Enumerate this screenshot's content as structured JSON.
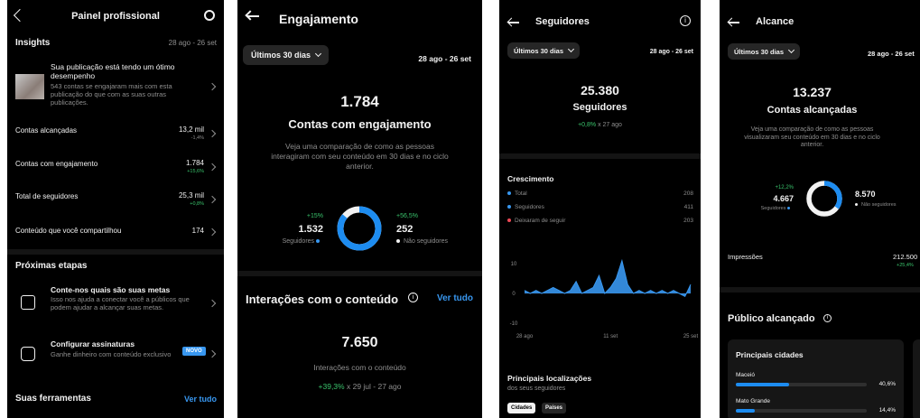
{
  "panel1": {
    "title": "Painel profissional",
    "insights_label": "Insights",
    "date_range": "28 ago - 26 set",
    "post": {
      "title": "Sua publicação está tendo um ótimo desempenho",
      "body": "543 contas se engajaram mais com esta publicação do que com as suas outras publicações."
    },
    "metrics": [
      {
        "label": "Contas alcançadas",
        "value": "13,2 mil",
        "change": "-1,4%"
      },
      {
        "label": "Contas com engajamento",
        "value": "1.784",
        "change": "+15,6%"
      },
      {
        "label": "Total de seguidores",
        "value": "25,3 mil",
        "change": "+0,8%"
      },
      {
        "label": "Conteúdo que você compartilhou",
        "value": "174",
        "change": ""
      }
    ],
    "next_steps_title": "Próximas etapas",
    "goals": {
      "title": "Conte-nos quais são suas metas",
      "body": "Isso nos ajuda a conectar você a públicos que podem ajudar a alcançar suas metas."
    },
    "subscriptions": {
      "title": "Configurar assinaturas",
      "body": "Ganhe dinheiro com conteúdo exclusivo",
      "badge": "NOVO"
    },
    "tools_title": "Suas ferramentas",
    "see_all": "Ver tudo"
  },
  "panel2": {
    "title": "Engajamento",
    "period": "Últimos 30 dias",
    "date_range": "28 ago - 26 set",
    "big_value": "1.784",
    "big_label": "Contas com engajamento",
    "description": "Veja uma comparação de como as pessoas interagiram com seu conteúdo em 30 dias e no ciclo anterior.",
    "followers": {
      "change": "+15%",
      "value": "1.532",
      "label": "Seguidores"
    },
    "non_followers": {
      "change": "+56,5%",
      "value": "252",
      "label": "Não seguidores"
    },
    "donut_fraction": 0.86,
    "interactions_title": "Interações com o conteúdo",
    "see_all": "Ver tudo",
    "interactions_value": "7.650",
    "interactions_label": "Interações com o conteúdo",
    "interactions_change": "+39,3%",
    "interactions_period": "x 29 jul - 27 ago"
  },
  "panel3": {
    "title": "Seguidores",
    "period": "Últimos 30 dias",
    "date_range": "28 ago - 26 set",
    "big_value": "25.380",
    "big_label": "Seguidores",
    "change": "+0,8%",
    "change_period": "x 27 ago",
    "growth_title": "Crescimento",
    "growth_rows": [
      {
        "label": "Total",
        "value": "208",
        "color": "#3897f0"
      },
      {
        "label": "Seguidores",
        "value": "411",
        "color": "#3897f0"
      },
      {
        "label": "Deixaram de seguir",
        "value": "203",
        "color": "#ed4956"
      }
    ],
    "y_ticks": [
      "10",
      "0",
      "-10"
    ],
    "x_ticks": [
      "28 ago",
      "11 set",
      "25 set"
    ],
    "locations_title": "Principais localizações",
    "locations_subtitle": "dos seus seguidores",
    "tabs": [
      "Cidades",
      "Países"
    ]
  },
  "chart_data": {
    "type": "area",
    "x": [
      1,
      2,
      3,
      4,
      5,
      6,
      7,
      8,
      9,
      10,
      11,
      12,
      13,
      14,
      15,
      16,
      17,
      18,
      19,
      20,
      21,
      22,
      23,
      24,
      25,
      26,
      27,
      28,
      29,
      30
    ],
    "values": [
      1,
      0,
      1,
      0,
      1,
      2,
      1,
      0,
      1,
      4,
      0,
      1,
      2,
      6,
      0,
      2,
      5,
      11,
      3,
      0,
      1,
      0,
      1,
      0,
      1,
      0,
      1,
      0,
      -1,
      3
    ],
    "ylim": [
      -10,
      10
    ],
    "x_tick_labels": [
      "28 ago",
      "11 set",
      "25 set"
    ],
    "color": "#3897f0"
  },
  "panel4": {
    "title": "Alcance",
    "period": "Últimos 30 dias",
    "date_range": "28 ago - 26 set",
    "big_value": "13.237",
    "big_label": "Contas alcançadas",
    "description": "Veja uma comparação de como as pessoas visualizaram seu conteúdo em 30 dias e no ciclo anterior.",
    "followers": {
      "change": "+12,2%",
      "value": "4.667",
      "label": "Seguidores"
    },
    "non_followers": {
      "value": "8.570",
      "label": "Não seguidores"
    },
    "donut_fraction": 0.35,
    "impressions_label": "Impressões",
    "impressions_value": "212.500",
    "impressions_change": "+25,4%",
    "audience_title": "Público alcançado",
    "cities_title": "Principais cidades",
    "cities": [
      {
        "name": "Maceió",
        "percent": "40,6%",
        "fraction": 0.406
      },
      {
        "name": "Mato Grande",
        "percent": "14,4%",
        "fraction": 0.144
      }
    ]
  }
}
